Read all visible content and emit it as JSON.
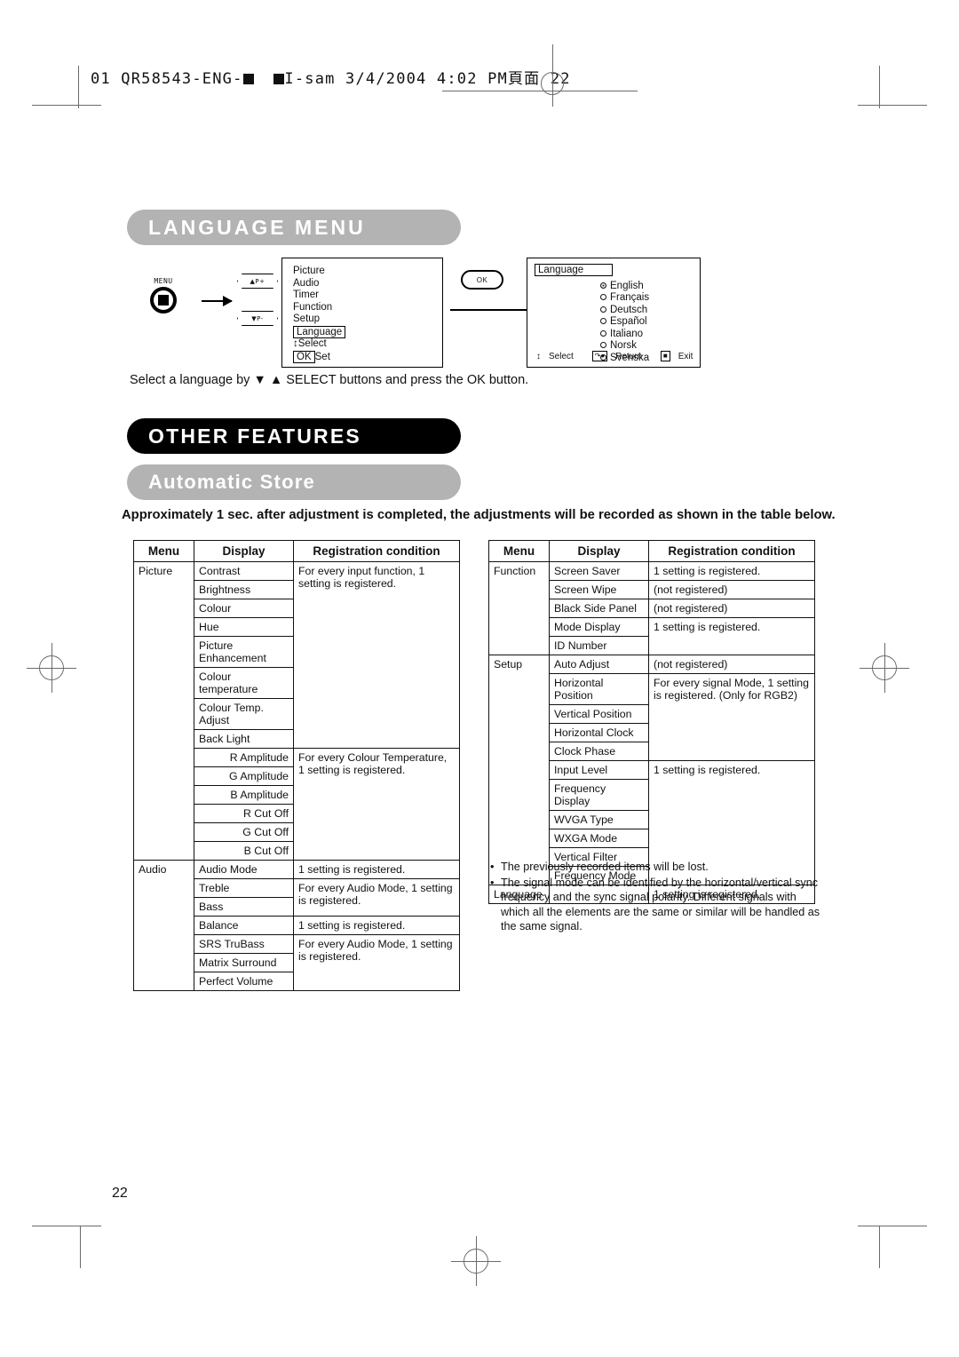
{
  "print_header": {
    "text_before": "01 QR58543-ENG-",
    "text_middle": "I-sam  3/4/2004  4:02 PM",
    "text_after": "22",
    "cjk": "頁面"
  },
  "sections": {
    "language_menu_banner": "LANGUAGE MENU",
    "other_features_banner": "OTHER FEATURES",
    "automatic_store_banner": "Automatic Store"
  },
  "diagram": {
    "menu_button_label": "MENU",
    "p_up_label": "▲P+",
    "p_down_label": "▼P-",
    "ok_button_label": "OK",
    "osd_menu_items": [
      "Picture",
      "Audio",
      "Timer",
      "Function",
      "Setup"
    ],
    "osd_highlighted_item": "Language",
    "osd_select_hint": "Select",
    "osd_set_key": "OK",
    "osd_set_hint": "Set",
    "language_panel_title": "Language",
    "languages": [
      {
        "name": "English",
        "selected": true
      },
      {
        "name": "Français",
        "selected": false
      },
      {
        "name": "Deutsch",
        "selected": false
      },
      {
        "name": "Español",
        "selected": false
      },
      {
        "name": "Italiano",
        "selected": false
      },
      {
        "name": "Norsk",
        "selected": false
      },
      {
        "name": "Svenska",
        "selected": false
      }
    ],
    "footer_select": "Select",
    "footer_return": "Return",
    "footer_exit": "Exit"
  },
  "caption": "Select a language by ▼ ▲ SELECT buttons and press the OK button.",
  "intro_bold": "Approximately 1 sec. after adjustment is completed, the adjustments will be recorded as shown in the table below.",
  "table_headers": {
    "menu": "Menu",
    "display": "Display",
    "registration": "Registration condition"
  },
  "table_left": {
    "menu_picture": "Picture",
    "menu_audio": "Audio",
    "rows": {
      "contrast": "Contrast",
      "brightness": "Brightness",
      "colour": "Colour",
      "hue": "Hue",
      "picture_enhancement": "Picture Enhancement",
      "colour_temperature": "Colour temperature",
      "colour_temp_adjust": "Colour Temp. Adjust",
      "back_light": "Back Light",
      "r_amplitude": "R Amplitude",
      "g_amplitude": "G Amplitude",
      "b_amplitude": "B Amplitude",
      "r_cut_off": "R Cut Off",
      "g_cut_off": "G Cut Off",
      "b_cut_off": "B Cut Off",
      "audio_mode": "Audio Mode",
      "treble": "Treble",
      "bass": "Bass",
      "balance": "Balance",
      "srs_trubass": "SRS TruBass",
      "matrix_surround": "Matrix Surround",
      "perfect_volume": "Perfect Volume"
    },
    "conditions": {
      "every_input": "For every input function, 1 setting is registered.",
      "every_colour_temp": "For every Colour Temperature, 1 setting is registered.",
      "one_setting": "1 setting is registered.",
      "every_audio_mode": "For every Audio Mode, 1 setting is registered.",
      "one_setting_2": "1 setting is registered.",
      "every_audio_mode_2": "For every Audio Mode, 1 setting is registered."
    }
  },
  "table_right": {
    "menu_function": "Function",
    "menu_setup": "Setup",
    "menu_language": "Language",
    "rows": {
      "screen_saver": "Screen Saver",
      "screen_wipe": "Screen Wipe",
      "black_side_panel": "Black Side Panel",
      "mode_display": "Mode Display",
      "id_number": "ID Number",
      "auto_adjust": "Auto Adjust",
      "horizontal_position": "Horizontal Position",
      "vertical_position": "Vertical Position",
      "horizontal_clock": "Horizontal Clock",
      "clock_phase": "Clock Phase",
      "input_level": "Input Level",
      "frequency_display": "Frequency Display",
      "wvga_type": "WVGA Type",
      "wxga_mode": "WXGA Mode",
      "vertical_filter": "Vertical Filter",
      "frequency_mode": "Frequency Mode",
      "language_blank": ""
    },
    "conditions": {
      "screen_saver_cond": "1 setting is registered.",
      "screen_wipe_cond": "(not registered)",
      "black_side_panel_cond": "(not registered)",
      "mode_display_cond": "1 setting is registered.",
      "auto_adjust_cond": "(not registered)",
      "signal_mode_cond": "For every signal Mode, 1 setting is registered. (Only for RGB2)",
      "input_level_cond": "1 setting is registered.",
      "language_cond": "1 setting is registered."
    }
  },
  "notes": [
    "The previously recorded items will be lost.",
    "The signal mode can be identified by the horizontal/vertical sync frequency and the sync signal polarity. Different signals with which all the elements are the same or similar will be handled as the same signal."
  ],
  "page_number": "22",
  "colors": {
    "banner_gray": "#b3b3b3",
    "banner_black": "#000000",
    "mark_gray": "#6b6b6b"
  }
}
